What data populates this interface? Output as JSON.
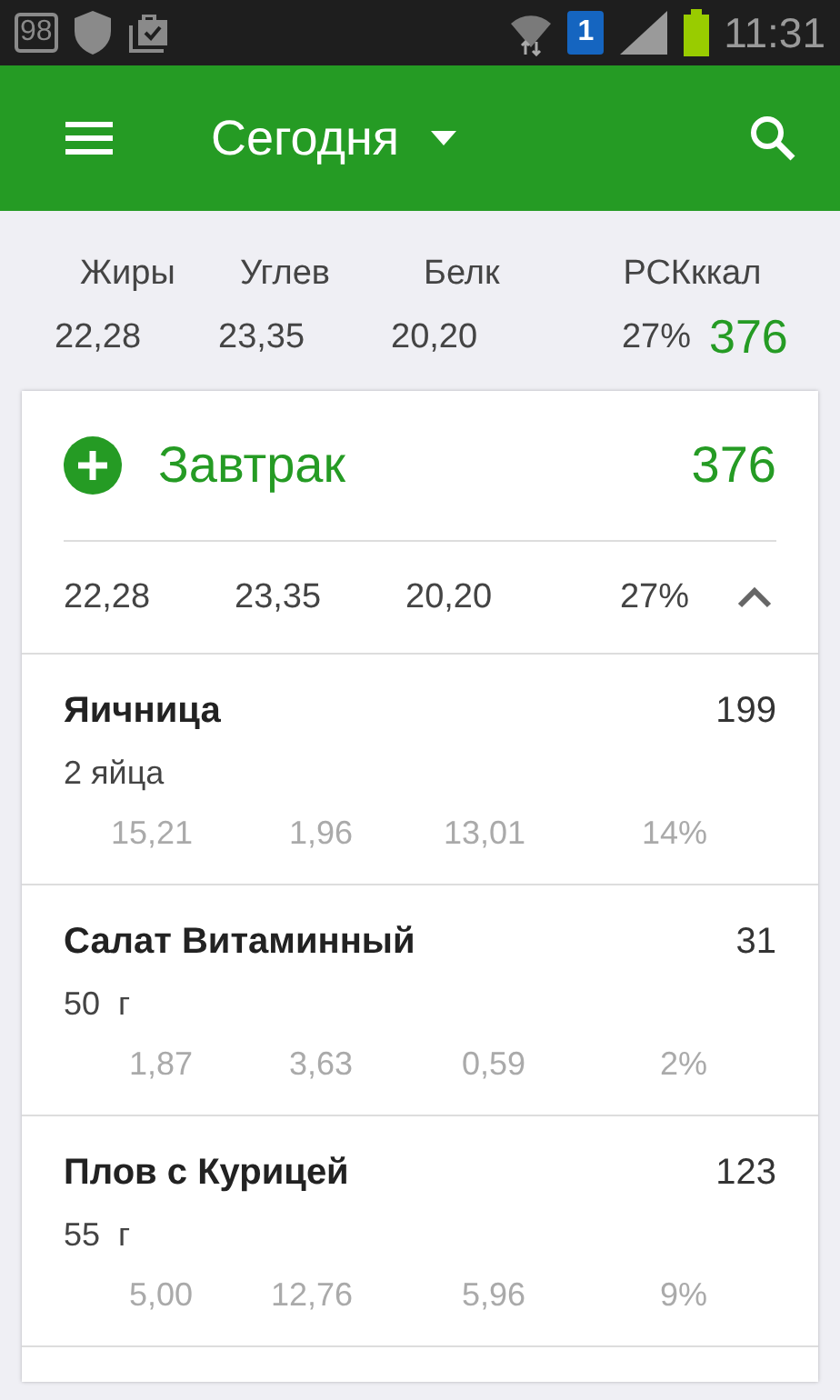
{
  "status_bar": {
    "notification_count": "98",
    "sim": "1",
    "time": "11:31"
  },
  "app_bar": {
    "title": "Сегодня"
  },
  "summary": {
    "labels": [
      "Жиры",
      "Углев",
      "Белк",
      "РСК",
      "ккал"
    ],
    "values": [
      "22,28",
      "23,35",
      "20,20",
      "27%"
    ],
    "calories": "376"
  },
  "meal": {
    "name": "Завтрак",
    "calories": "376",
    "expanded": true,
    "totals": [
      "22,28",
      "23,35",
      "20,20",
      "27%"
    ],
    "items": [
      {
        "name": "Яичница",
        "calories": "199",
        "portion": "2 яйца",
        "macros": [
          "15,21",
          "1,96",
          "13,01",
          "14%"
        ]
      },
      {
        "name": "Салат Витаминный",
        "calories": "31",
        "portion": "50  г",
        "macros": [
          "1,87",
          "3,63",
          "0,59",
          "2%"
        ]
      },
      {
        "name": "Плов с Курицей",
        "calories": "123",
        "portion": "55  г",
        "macros": [
          "5,00",
          "12,76",
          "5,96",
          "9%"
        ]
      }
    ]
  }
}
